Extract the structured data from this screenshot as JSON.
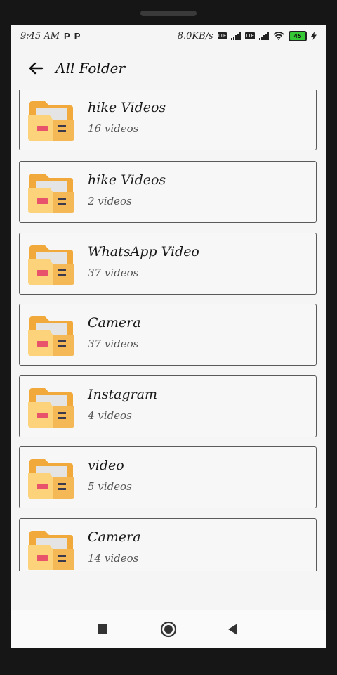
{
  "status_bar": {
    "time": "9:45 AM",
    "notif_1": "P",
    "notif_2": "P",
    "net_speed": "8.0KB/s",
    "battery": "45"
  },
  "toolbar": {
    "back_icon": "arrow-left-icon",
    "title": "All Folder"
  },
  "folders": [
    {
      "name": "hike Videos",
      "count": "16 videos"
    },
    {
      "name": "hike Videos",
      "count": "2 videos"
    },
    {
      "name": "WhatsApp Video",
      "count": "37 videos"
    },
    {
      "name": "Camera",
      "count": "37 videos"
    },
    {
      "name": "Instagram",
      "count": "4 videos"
    },
    {
      "name": "video",
      "count": "5 videos"
    },
    {
      "name": "Camera",
      "count": "14 videos"
    }
  ],
  "nav": {
    "recents_icon": "square-icon",
    "home_icon": "circle-icon",
    "back_icon": "triangle-back-icon"
  },
  "colors": {
    "folder_back": "#f2a93b",
    "folder_front": "#fcd27b",
    "folder_paper": "#e4e4e4",
    "folder_red": "#e8536b",
    "folder_dark": "#3b3b4d"
  }
}
